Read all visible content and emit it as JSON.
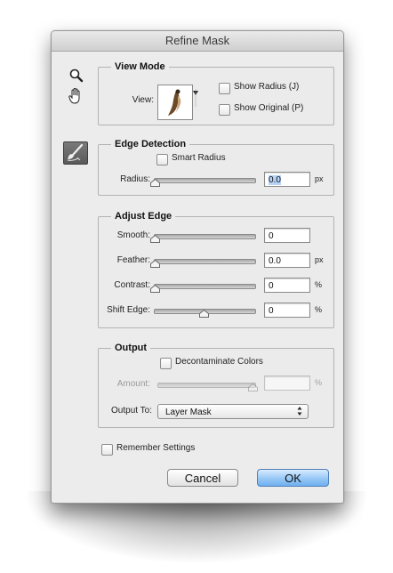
{
  "window": {
    "title": "Refine Mask"
  },
  "tools": {
    "zoom": "zoom-icon",
    "hand": "hand-icon",
    "brush": "refine-radius-brush-icon"
  },
  "view_mode": {
    "legend": "View Mode",
    "view_label": "View:",
    "show_radius": {
      "label": "Show Radius (J)",
      "checked": false
    },
    "show_original": {
      "label": "Show Original (P)",
      "checked": false
    }
  },
  "edge_detection": {
    "legend": "Edge Detection",
    "smart_radius": {
      "label": "Smart Radius",
      "checked": false
    },
    "radius": {
      "label": "Radius:",
      "value": "0.0",
      "unit": "px",
      "level": 0
    }
  },
  "adjust_edge": {
    "legend": "Adjust Edge",
    "smooth": {
      "label": "Smooth:",
      "value": "0",
      "unit": "",
      "level": 0
    },
    "feather": {
      "label": "Feather:",
      "value": "0.0",
      "unit": "px",
      "level": 0
    },
    "contrast": {
      "label": "Contrast:",
      "value": "0",
      "unit": "%",
      "level": 0
    },
    "shift_edge": {
      "label": "Shift Edge:",
      "value": "0",
      "unit": "%",
      "level": 0.5
    }
  },
  "output": {
    "legend": "Output",
    "decontaminate": {
      "label": "Decontaminate Colors",
      "checked": false
    },
    "amount": {
      "label": "Amount:",
      "value": "",
      "unit": "%",
      "level": 1,
      "enabled": false
    },
    "output_to_label": "Output To:",
    "output_to_value": "Layer Mask",
    "select_arrows": "▲▼"
  },
  "remember": {
    "label": "Remember Settings",
    "checked": false
  },
  "buttons": {
    "cancel": "Cancel",
    "ok": "OK"
  },
  "colors": {
    "ok_button": "#8cc1f4",
    "dialog_bg": "#ececec",
    "selection": "#b7d3f7"
  }
}
